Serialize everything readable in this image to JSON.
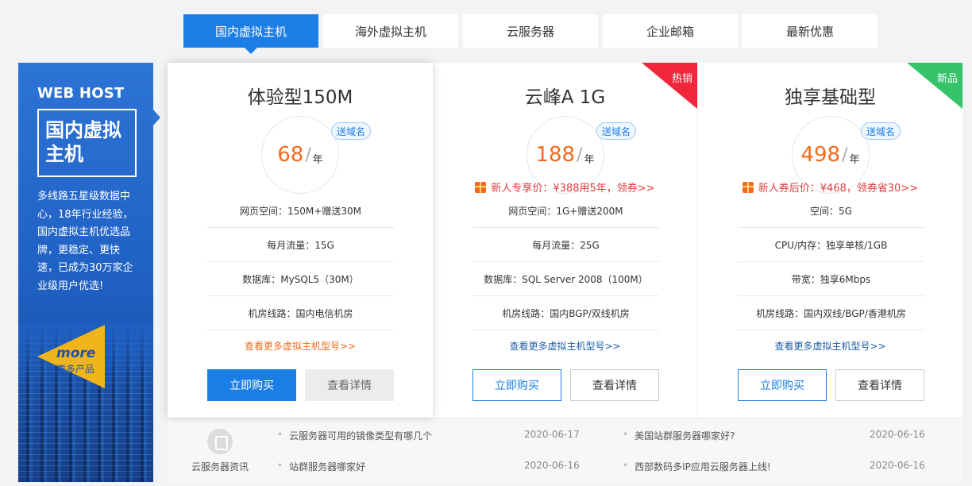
{
  "tabs": [
    {
      "label": "国内虚拟主机",
      "active": true
    },
    {
      "label": "海外虚拟主机",
      "active": false
    },
    {
      "label": "云服务器",
      "active": false
    },
    {
      "label": "企业邮箱",
      "active": false
    },
    {
      "label": "最新优惠",
      "active": false
    }
  ],
  "banner": {
    "en_title": "WEB HOST",
    "box_title": "国内虚拟主机",
    "description": "多线路五星级数据中心，18年行业经验，国内虚拟主机优选品牌，更稳定、更快速，已成为30万家企业级用户优选!",
    "more_en": "more",
    "more_cn": "更多产品"
  },
  "cards": [
    {
      "title": "体验型150M",
      "price": "68",
      "sep": "/",
      "unit": "年",
      "domain_tag": "送域名",
      "promo": "",
      "specs": [
        "网页空间：150M+赠送30M",
        "每月流量：15G",
        "数据库：MySQL5（30M）",
        "机房线路：国内电信机房"
      ],
      "more_link": "查看更多虚拟主机型号>>",
      "buy_label": "立即购买",
      "detail_label": "查看详情",
      "corner": ""
    },
    {
      "title": "云峰A 1G",
      "price": "188",
      "sep": "/",
      "unit": "年",
      "domain_tag": "送域名",
      "promo": "新人专享价：¥388用5年，领券>>",
      "specs": [
        "网页空间：1G+赠送200M",
        "每月流量：25G",
        "数据库：SQL Server 2008（100M）",
        "机房线路：国内BGP/双线机房"
      ],
      "more_link": "查看更多虚拟主机型号>>",
      "buy_label": "立即购买",
      "detail_label": "查看详情",
      "corner": "热销"
    },
    {
      "title": "独享基础型",
      "price": "498",
      "sep": "/",
      "unit": "年",
      "domain_tag": "送域名",
      "promo": "新人券后价：¥468，领券省30>>",
      "specs": [
        "空间：5G",
        "CPU/内存：独享单核/1GB",
        "带宽：独享6Mbps",
        "机房线路：国内双线/BGP/香港机房"
      ],
      "more_link": "查看更多虚拟主机型号>>",
      "buy_label": "立即购买",
      "detail_label": "查看详情",
      "corner": "新品"
    }
  ],
  "colors": {
    "accent": "#1b7ee6",
    "price": "#f26b1d",
    "promo": "#e23b3b",
    "hot": "#f0273a",
    "new": "#35c46a"
  },
  "news": {
    "label": "云服务器资讯",
    "icon": "news-icon",
    "items": [
      {
        "title": "云服务器可用的镜像类型有哪几个",
        "date": "2020-06-17"
      },
      {
        "title": "美国站群服务器哪家好?",
        "date": "2020-06-16"
      },
      {
        "title": "站群服务器哪家好",
        "date": "2020-06-16"
      },
      {
        "title": "西部数码多IP应用云服务器上线!",
        "date": "2020-06-16"
      }
    ]
  }
}
